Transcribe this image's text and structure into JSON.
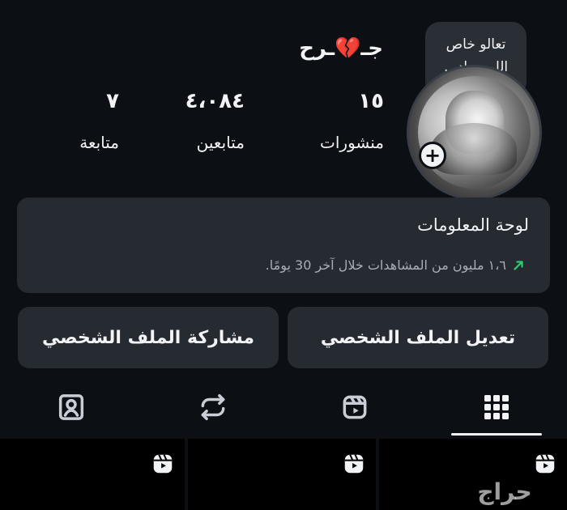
{
  "profile": {
    "name_left": "جـ",
    "name_heart": "💔",
    "name_right": "ـرح",
    "note": "تعالو خاص\nاللي صاد…",
    "stats": {
      "posts": {
        "value": "١٥",
        "label": "منشورات"
      },
      "followers": {
        "value": "٤،٠٨٤",
        "label": "متابعين"
      },
      "following": {
        "value": "٧",
        "label": "متابعة"
      }
    }
  },
  "dashboard": {
    "title": "لوحة المعلومات",
    "subtitle": "١،٦ مليون من المشاهدات خلال آخر 30 يومًا."
  },
  "actions": {
    "edit_profile": "تعديل الملف الشخصي",
    "share_profile": "مشاركة الملف الشخصي"
  },
  "tabs": [
    {
      "name": "grid",
      "icon": "grid-icon",
      "selected": true
    },
    {
      "name": "reels",
      "icon": "reels-icon",
      "selected": false
    },
    {
      "name": "reposts",
      "icon": "repost-icon",
      "selected": false
    },
    {
      "name": "tagged",
      "icon": "tagged-icon",
      "selected": false
    }
  ],
  "grid": {
    "items": [
      {
        "type": "reel",
        "icon": "reels-icon"
      },
      {
        "type": "reel",
        "icon": "reels-icon"
      },
      {
        "type": "reel",
        "icon": "reels-icon"
      }
    ]
  },
  "watermark": {
    "text": "حراج"
  },
  "colors": {
    "background": "#0c0f14",
    "card": "#262a31",
    "text": "#f2f3f5",
    "muted": "#a8aeb7",
    "trend": "#2ecc71",
    "heart": "#ff3b5a"
  }
}
